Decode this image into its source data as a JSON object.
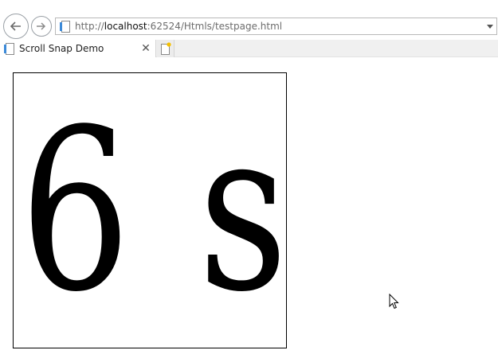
{
  "browser": {
    "url_prefix": "http://",
    "url_host": "localhost",
    "url_rest": ":62524/Htmls/testpage.html",
    "tab_title": "Scroll Snap Demo",
    "tab_close_glyph": "✕",
    "icons": {
      "back": "back-arrow-icon",
      "forward": "forward-arrow-icon",
      "page": "page-icon",
      "dropdown": "chevron-down-icon",
      "new_tab": "new-tab-icon"
    }
  },
  "content": {
    "snap_items": [
      "6",
      "s"
    ]
  }
}
